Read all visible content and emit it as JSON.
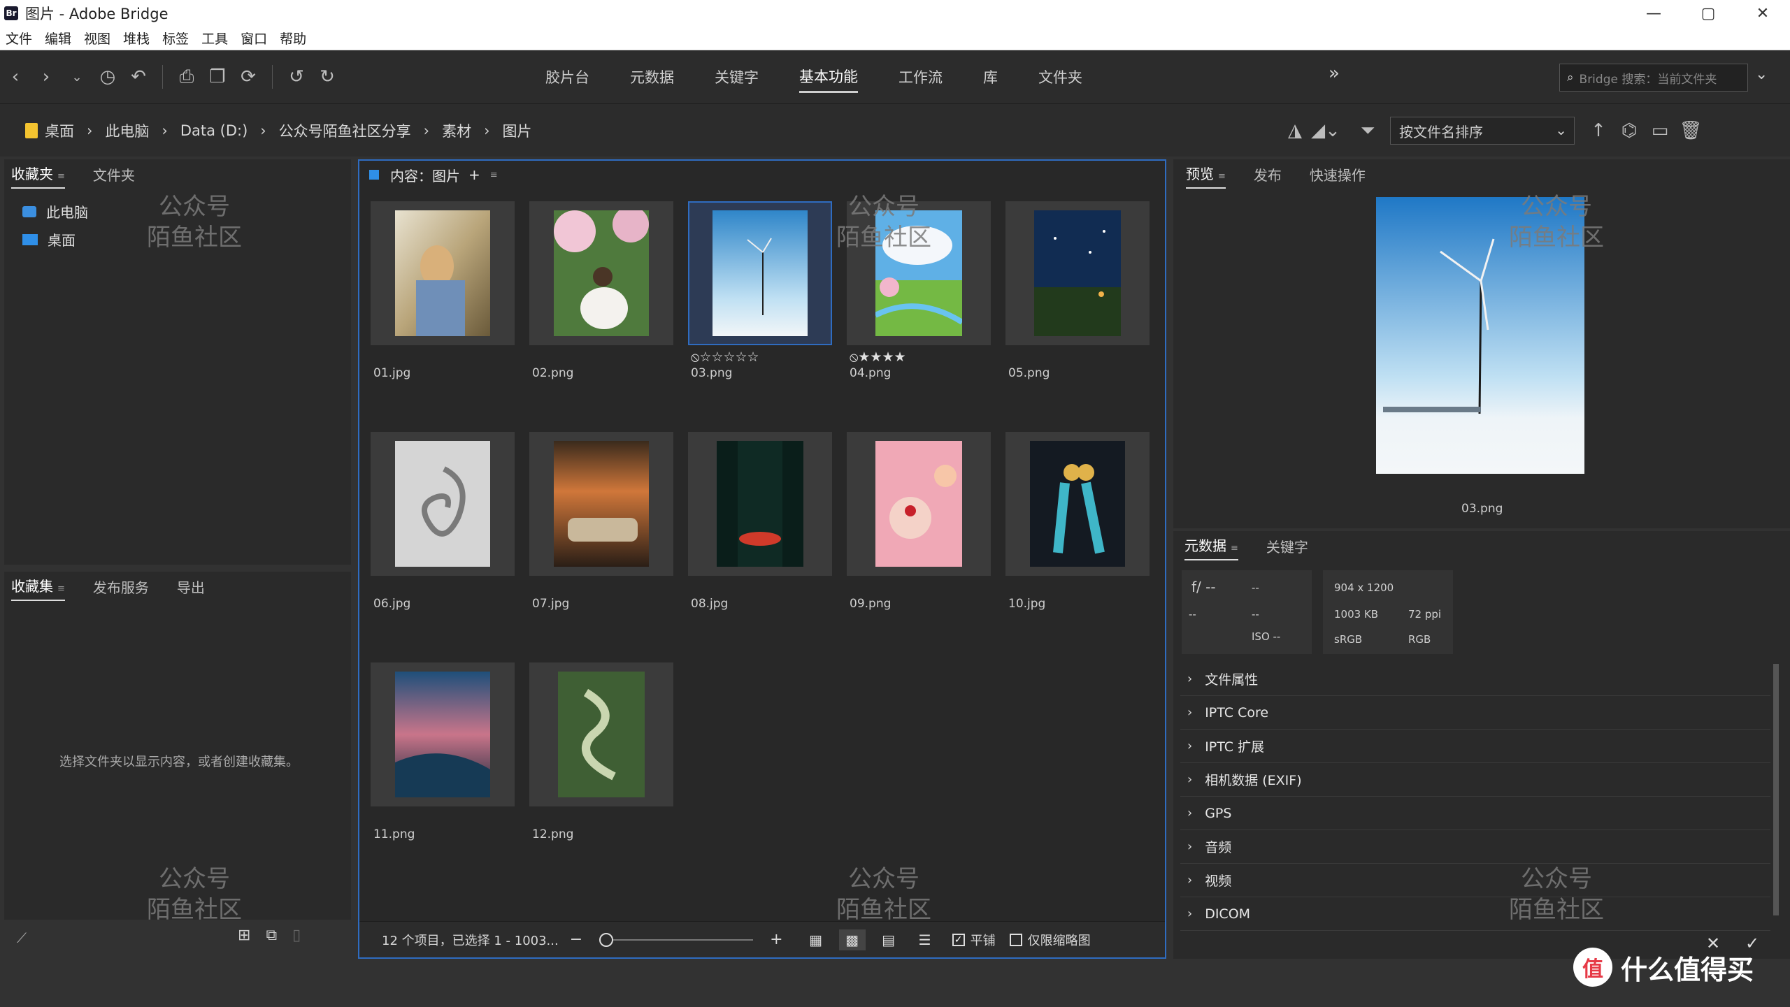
{
  "window": {
    "title": "图片 - Adobe Bridge",
    "app_icon": "Br"
  },
  "menu": [
    "文件",
    "编辑",
    "视图",
    "堆栈",
    "标签",
    "工具",
    "窗口",
    "帮助"
  ],
  "workspaces": {
    "tabs": [
      "胶片台",
      "元数据",
      "关键字",
      "基本功能",
      "工作流",
      "库",
      "文件夹"
    ],
    "active": "基本功能",
    "more": "»"
  },
  "search": {
    "placeholder": "Bridge 搜索：当前文件夹"
  },
  "breadcrumb": [
    "桌面",
    "此电脑",
    "Data (D:)",
    "公众号陌鱼社区分享",
    "素材",
    "图片"
  ],
  "sort": {
    "label": "按文件名排序"
  },
  "favorites_panel": {
    "tabs": [
      "收藏夹",
      "文件夹"
    ],
    "items": [
      "此电脑",
      "桌面"
    ]
  },
  "collections_panel": {
    "tabs": [
      "收藏集",
      "发布服务",
      "导出"
    ],
    "message": "选择文件夹以显示内容，或者创建收藏集。"
  },
  "content": {
    "title": "内容：图片",
    "items": [
      {
        "name": "01.jpg",
        "stars": ""
      },
      {
        "name": "02.png",
        "stars": ""
      },
      {
        "name": "03.png",
        "stars": "⦸☆☆☆☆☆"
      },
      {
        "name": "04.png",
        "stars": "⦸★★★★"
      },
      {
        "name": "05.png",
        "stars": ""
      },
      {
        "name": "06.jpg",
        "stars": ""
      },
      {
        "name": "07.jpg",
        "stars": ""
      },
      {
        "name": "08.jpg",
        "stars": ""
      },
      {
        "name": "09.png",
        "stars": ""
      },
      {
        "name": "10.jpg",
        "stars": ""
      },
      {
        "name": "11.png",
        "stars": ""
      },
      {
        "name": "12.png",
        "stars": ""
      }
    ],
    "status": "12 个项目，已选择 1 - 1003...",
    "lock_label": "平铺",
    "thumbs_only_label": "仅限缩略图"
  },
  "preview_panel": {
    "tabs": [
      "预览",
      "发布",
      "快速操作"
    ],
    "filename": "03.png"
  },
  "metadata_panel": {
    "tabs": [
      "元数据",
      "关键字"
    ],
    "camera": {
      "aperture": "f/ --",
      "shutter": "--",
      "iso": "ISO --",
      "a": "--",
      "b": "--"
    },
    "file": {
      "dimensions": "904 x 1200",
      "size": "1003 KB",
      "profile": "sRGB",
      "ppi": "72 ppi",
      "mode": "RGB"
    },
    "sections": [
      "文件属性",
      "IPTC Core",
      "IPTC 扩展",
      "相机数据 (EXIF)",
      "GPS",
      "音频",
      "视频",
      "DICOM"
    ]
  },
  "watermark": {
    "line1": "公众号",
    "line2": "陌鱼社区"
  },
  "brand": "什么值得买",
  "colors": {
    "accent": "#2f6cc0",
    "bg": "#323232",
    "panel": "#2a2a2a"
  }
}
